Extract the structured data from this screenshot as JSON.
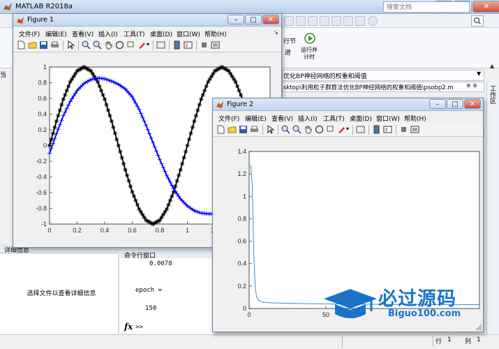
{
  "app": {
    "title": "MATLAB R2018a",
    "search_placeholder": "搜索文档",
    "ribbon": {
      "run_section": "行节",
      "run_advance": "进",
      "run_and_time": "运行并计时"
    },
    "document_title": "优化BP神经网络的权重和阈值",
    "path": "sktop\\利用粒子群算法优化BP神经网络的权重和阈值\\psobp2.m",
    "workspace_label": "工作区",
    "left_edge_label": "当"
  },
  "details_panel": {
    "title": "详细信息",
    "message": "选择文件以查看详细信息"
  },
  "command_window": {
    "title": "命令行窗口",
    "lines": [
      "0.0078",
      "epoch =",
      "150"
    ],
    "fx": "fx",
    "prompt": ">>"
  },
  "statusbar": {
    "row_label": "行",
    "row_value": "1",
    "col_label": "列",
    "col_value": "1"
  },
  "figure_menu": [
    "文件(F)",
    "编辑(E)",
    "查看(V)",
    "插入(I)",
    "工具(T)",
    "桌面(D)",
    "窗口(W)",
    "帮助(H)"
  ],
  "figure1": {
    "title": "Figure 1"
  },
  "figure2": {
    "title": "Figure 2"
  },
  "watermark": {
    "title": "必过源码",
    "url": "Biguo100.com"
  },
  "colors": {
    "black_series": "#000000",
    "blue_series": "#0000ff",
    "error_line": "#3d8fc7"
  },
  "chart_data": [
    {
      "type": "line",
      "title": "",
      "xlabel": "",
      "ylabel": "",
      "xlim": [
        0,
        1.6
      ],
      "ylim": [
        -1,
        1
      ],
      "xticks": [
        0,
        0.2,
        0.4,
        0.6,
        0.8,
        1,
        1.2,
        1.4
      ],
      "yticks": [
        -1,
        -0.8,
        -0.6,
        -0.4,
        -0.2,
        0,
        0.2,
        0.4,
        0.6,
        0.8,
        1
      ],
      "xtick_labels": [
        "0",
        "0.2",
        "0.4",
        "0.6",
        "0.8",
        "1",
        "1.2",
        "1.4",
        "1"
      ],
      "ytick_labels": [
        "-1",
        "-0.8",
        "-0.6",
        "-0.4",
        "-0.2",
        "0",
        "0.2",
        "0.4",
        "0.6",
        "0.8",
        "1"
      ],
      "grid": false,
      "legend": "none",
      "series": [
        {
          "color": "#000000",
          "marker": "*",
          "x": [
            0,
            0.05,
            0.1,
            0.15,
            0.2,
            0.25,
            0.3,
            0.35,
            0.4,
            0.45,
            0.5,
            0.55,
            0.6,
            0.65,
            0.7,
            0.75,
            0.8,
            0.85,
            0.9,
            0.95,
            1.0,
            1.05,
            1.1,
            1.15,
            1.2,
            1.25,
            1.3,
            1.35,
            1.4,
            1.45,
            1.5,
            1.55,
            1.6
          ],
          "y": [
            0,
            0.31,
            0.59,
            0.81,
            0.95,
            1.0,
            0.95,
            0.81,
            0.59,
            0.31,
            0.0,
            -0.31,
            -0.59,
            -0.81,
            -0.95,
            -1.0,
            -0.95,
            -0.81,
            -0.59,
            -0.31,
            0.0,
            0.31,
            0.59,
            0.81,
            0.95,
            1.0,
            0.95,
            0.81,
            0.59,
            0.31,
            0.0,
            -0.31,
            -0.59
          ]
        },
        {
          "color": "#0000ff",
          "marker": "+",
          "x": [
            0,
            0.05,
            0.1,
            0.15,
            0.2,
            0.25,
            0.3,
            0.35,
            0.4,
            0.45,
            0.5,
            0.55,
            0.6,
            0.65,
            0.7,
            0.75,
            0.8,
            0.85,
            0.9,
            0.95,
            1.0,
            1.05,
            1.1,
            1.15,
            1.2,
            1.25,
            1.3,
            1.35,
            1.4,
            1.45,
            1.5,
            1.55,
            1.6
          ],
          "y": [
            -0.1,
            0.15,
            0.38,
            0.56,
            0.7,
            0.79,
            0.84,
            0.86,
            0.85,
            0.82,
            0.78,
            0.72,
            0.62,
            0.46,
            0.26,
            0.04,
            -0.18,
            -0.38,
            -0.55,
            -0.68,
            -0.77,
            -0.83,
            -0.86,
            -0.87,
            -0.87,
            -0.86,
            -0.85,
            -0.84,
            -0.84,
            -0.84,
            -0.85,
            -0.86,
            -0.86
          ]
        }
      ]
    },
    {
      "type": "line",
      "title": "",
      "xlabel": "",
      "ylabel": "",
      "xlim": [
        0,
        150
      ],
      "ylim": [
        0,
        1.4
      ],
      "xticks": [
        0,
        50
      ],
      "yticks": [
        0,
        0.2,
        0.4,
        0.6,
        0.8,
        1,
        1.2,
        1.4
      ],
      "xtick_labels": [
        "0",
        "50"
      ],
      "ytick_labels": [
        "0",
        "0.2",
        "0.4",
        "0.6",
        "0.8",
        "1",
        "1.2",
        "1.4"
      ],
      "grid": false,
      "legend": "none",
      "series": [
        {
          "color": "#3d8fc7",
          "x": [
            1,
            2,
            3,
            4,
            5,
            6,
            8,
            10,
            15,
            20,
            30,
            40,
            60,
            80,
            100,
            120,
            150
          ],
          "y": [
            1.28,
            1.1,
            0.5,
            0.18,
            0.1,
            0.075,
            0.06,
            0.055,
            0.05,
            0.048,
            0.045,
            0.043,
            0.04,
            0.038,
            0.036,
            0.035,
            0.034
          ]
        }
      ]
    }
  ]
}
